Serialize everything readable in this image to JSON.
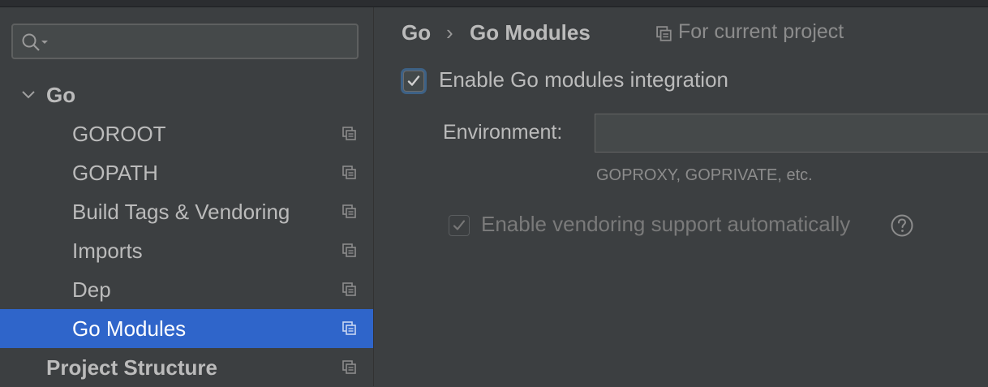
{
  "search": {
    "placeholder": ""
  },
  "tree": [
    {
      "label": "Go",
      "level": 0,
      "expanded": true,
      "bold": true
    },
    {
      "label": "GOROOT",
      "level": 1
    },
    {
      "label": "GOPATH",
      "level": 1
    },
    {
      "label": "Build Tags & Vendoring",
      "level": 1
    },
    {
      "label": "Imports",
      "level": 1
    },
    {
      "label": "Dep",
      "level": 1
    },
    {
      "label": "Go Modules",
      "level": 1,
      "selected": true
    },
    {
      "label": "Project Structure",
      "level": 0,
      "bold": true
    }
  ],
  "breadcrumb": {
    "root": "Go",
    "separator": "›",
    "current": "Go Modules"
  },
  "scope_label": "For current project",
  "modules": {
    "enable_label": "Enable Go modules integration",
    "enable_checked": true,
    "environment_label": "Environment:",
    "environment_value": "",
    "environment_hint": "GOPROXY, GOPRIVATE, etc.",
    "vendoring_label": "Enable vendoring support automatically",
    "vendoring_checked": true,
    "vendoring_disabled": true
  },
  "colors": {
    "background": "#3c3f41",
    "selection": "#2f65ca",
    "text": "#bbbbbb",
    "muted": "#8c8c8c"
  }
}
